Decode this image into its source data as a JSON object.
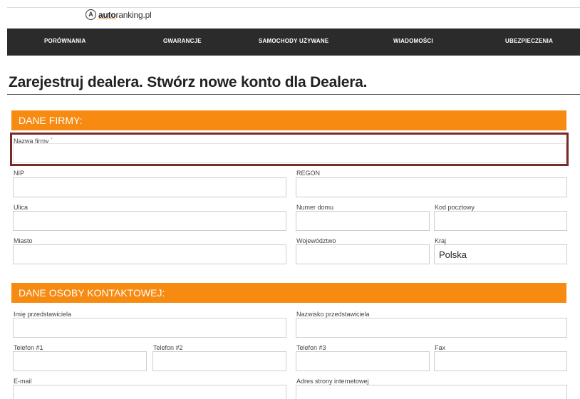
{
  "header": {
    "logo_mark": "A",
    "logo_brand": "auto",
    "logo_rest": "ranking.pl"
  },
  "nav": {
    "items": [
      {
        "label": "PORÓWNANIA"
      },
      {
        "label": "GWARANCJE"
      },
      {
        "label": "SAMOCHODY UŻYWANE"
      },
      {
        "label": "WIADOMOŚCI"
      },
      {
        "label": "UBEZPIECZENIA"
      }
    ]
  },
  "page": {
    "title": "Zarejestruj dealera.  Stwórz nowe konto dla Dealera."
  },
  "company_section": {
    "heading": "DANE FIRMY:",
    "company_name": {
      "label": "Nazwa firmy",
      "required_mark": "*",
      "value": ""
    },
    "nip": {
      "label": "NIP",
      "value": ""
    },
    "regon": {
      "label": "REGON",
      "value": ""
    },
    "street": {
      "label": "Ulica",
      "value": ""
    },
    "house_number": {
      "label": "Numer domu",
      "value": ""
    },
    "postal_code": {
      "label": "Kod pocztowy",
      "value": ""
    },
    "city": {
      "label": "Miasto",
      "value": ""
    },
    "voivodeship": {
      "label": "Województwo",
      "value": ""
    },
    "country": {
      "label": "Kraj",
      "value": "Polska"
    }
  },
  "contact_section": {
    "heading": "DANE OSOBY KONTAKTOWEJ:",
    "first_name": {
      "label": "Imię przedstawiciela",
      "value": ""
    },
    "last_name": {
      "label": "Nazwisko przedstawiciela",
      "value": ""
    },
    "phone1": {
      "label": "Telefon #1",
      "value": ""
    },
    "phone2": {
      "label": "Telefon #2",
      "value": ""
    },
    "phone3": {
      "label": "Telefon #3",
      "value": ""
    },
    "fax": {
      "label": "Fax",
      "value": ""
    },
    "email": {
      "label": "E-mail",
      "value": ""
    },
    "website": {
      "label": "Adres strony internetowej",
      "value": ""
    }
  },
  "colors": {
    "accent": "#f78a10",
    "nav_background": "#2b2b2b",
    "highlight_border": "#7b2a2a"
  }
}
